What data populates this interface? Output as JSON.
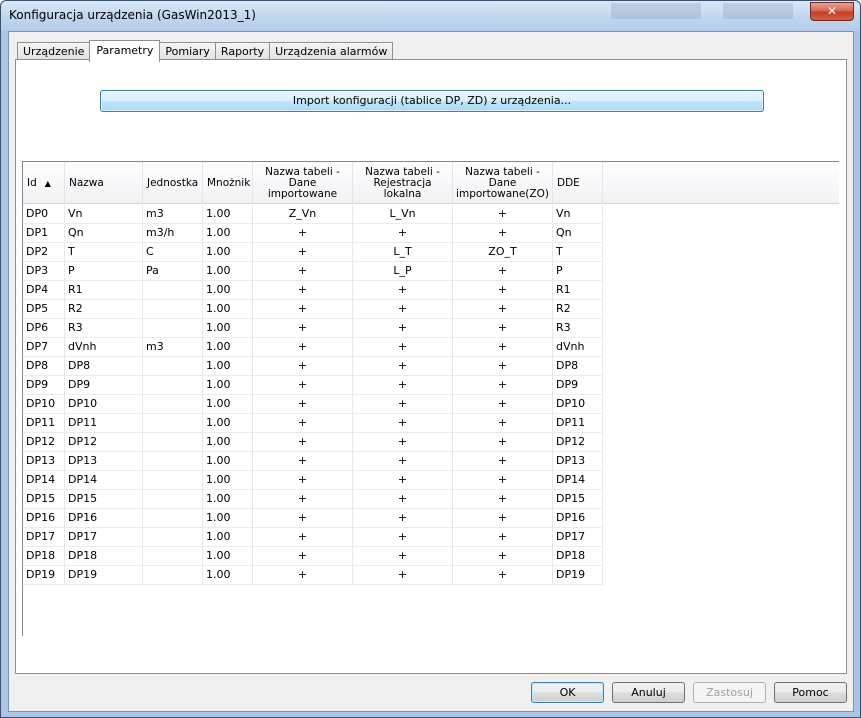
{
  "window": {
    "title": "Konfiguracja urządzenia (GasWin2013_1)",
    "close_glyph": "✕"
  },
  "tabs": [
    {
      "label": "Urządzenie"
    },
    {
      "label": "Parametry"
    },
    {
      "label": "Pomiary"
    },
    {
      "label": "Raporty"
    },
    {
      "label": "Urządzenia alarmów"
    }
  ],
  "active_tab": "Parametry",
  "import_button": {
    "label": "Import konfiguracji (tablice DP, ZD) z urządzenia..."
  },
  "table": {
    "columns": [
      {
        "key": "id",
        "label": "Id"
      },
      {
        "key": "nazwa",
        "label": "Nazwa"
      },
      {
        "key": "jednostka",
        "label": "Jednostka"
      },
      {
        "key": "mnoznik",
        "label": "Mnożnik"
      },
      {
        "key": "dane_imp",
        "label": "Nazwa tabeli - Dane importowane"
      },
      {
        "key": "rej_lok",
        "label": "Nazwa tabeli - Rejestracja lokalna"
      },
      {
        "key": "dane_imp_zo",
        "label": "Nazwa tabeli - Dane importowane(ZO)"
      },
      {
        "key": "dde",
        "label": "DDE"
      }
    ],
    "sort_indicator": "▲",
    "rows": [
      [
        "DP0",
        "Vn",
        "m3",
        "1.00",
        "Z_Vn",
        "L_Vn",
        "+",
        "Vn"
      ],
      [
        "DP1",
        "Qn",
        "m3/h",
        "1.00",
        "+",
        "+",
        "+",
        "Qn"
      ],
      [
        "DP2",
        "T",
        "C",
        "1.00",
        "+",
        "L_T",
        "ZO_T",
        "T"
      ],
      [
        "DP3",
        "P",
        "Pa",
        "1.00",
        "+",
        "L_P",
        "+",
        "P"
      ],
      [
        "DP4",
        "R1",
        "",
        "1.00",
        "+",
        "+",
        "+",
        "R1"
      ],
      [
        "DP5",
        "R2",
        "",
        "1.00",
        "+",
        "+",
        "+",
        "R2"
      ],
      [
        "DP6",
        "R3",
        "",
        "1.00",
        "+",
        "+",
        "+",
        "R3"
      ],
      [
        "DP7",
        "dVnh",
        "m3",
        "1.00",
        "+",
        "+",
        "+",
        "dVnh"
      ],
      [
        "DP8",
        "DP8",
        "",
        "1.00",
        "+",
        "+",
        "+",
        "DP8"
      ],
      [
        "DP9",
        "DP9",
        "",
        "1.00",
        "+",
        "+",
        "+",
        "DP9"
      ],
      [
        "DP10",
        "DP10",
        "",
        "1.00",
        "+",
        "+",
        "+",
        "DP10"
      ],
      [
        "DP11",
        "DP11",
        "",
        "1.00",
        "+",
        "+",
        "+",
        "DP11"
      ],
      [
        "DP12",
        "DP12",
        "",
        "1.00",
        "+",
        "+",
        "+",
        "DP12"
      ],
      [
        "DP13",
        "DP13",
        "",
        "1.00",
        "+",
        "+",
        "+",
        "DP13"
      ],
      [
        "DP14",
        "DP14",
        "",
        "1.00",
        "+",
        "+",
        "+",
        "DP14"
      ],
      [
        "DP15",
        "DP15",
        "",
        "1.00",
        "+",
        "+",
        "+",
        "DP15"
      ],
      [
        "DP16",
        "DP16",
        "",
        "1.00",
        "+",
        "+",
        "+",
        "DP16"
      ],
      [
        "DP17",
        "DP17",
        "",
        "1.00",
        "+",
        "+",
        "+",
        "DP17"
      ],
      [
        "DP18",
        "DP18",
        "",
        "1.00",
        "+",
        "+",
        "+",
        "DP18"
      ],
      [
        "DP19",
        "DP19",
        "",
        "1.00",
        "+",
        "+",
        "+",
        "DP19"
      ]
    ]
  },
  "buttons": {
    "ok": "OK",
    "cancel": "Anuluj",
    "apply": "Zastosuj",
    "help": "Pomoc"
  }
}
